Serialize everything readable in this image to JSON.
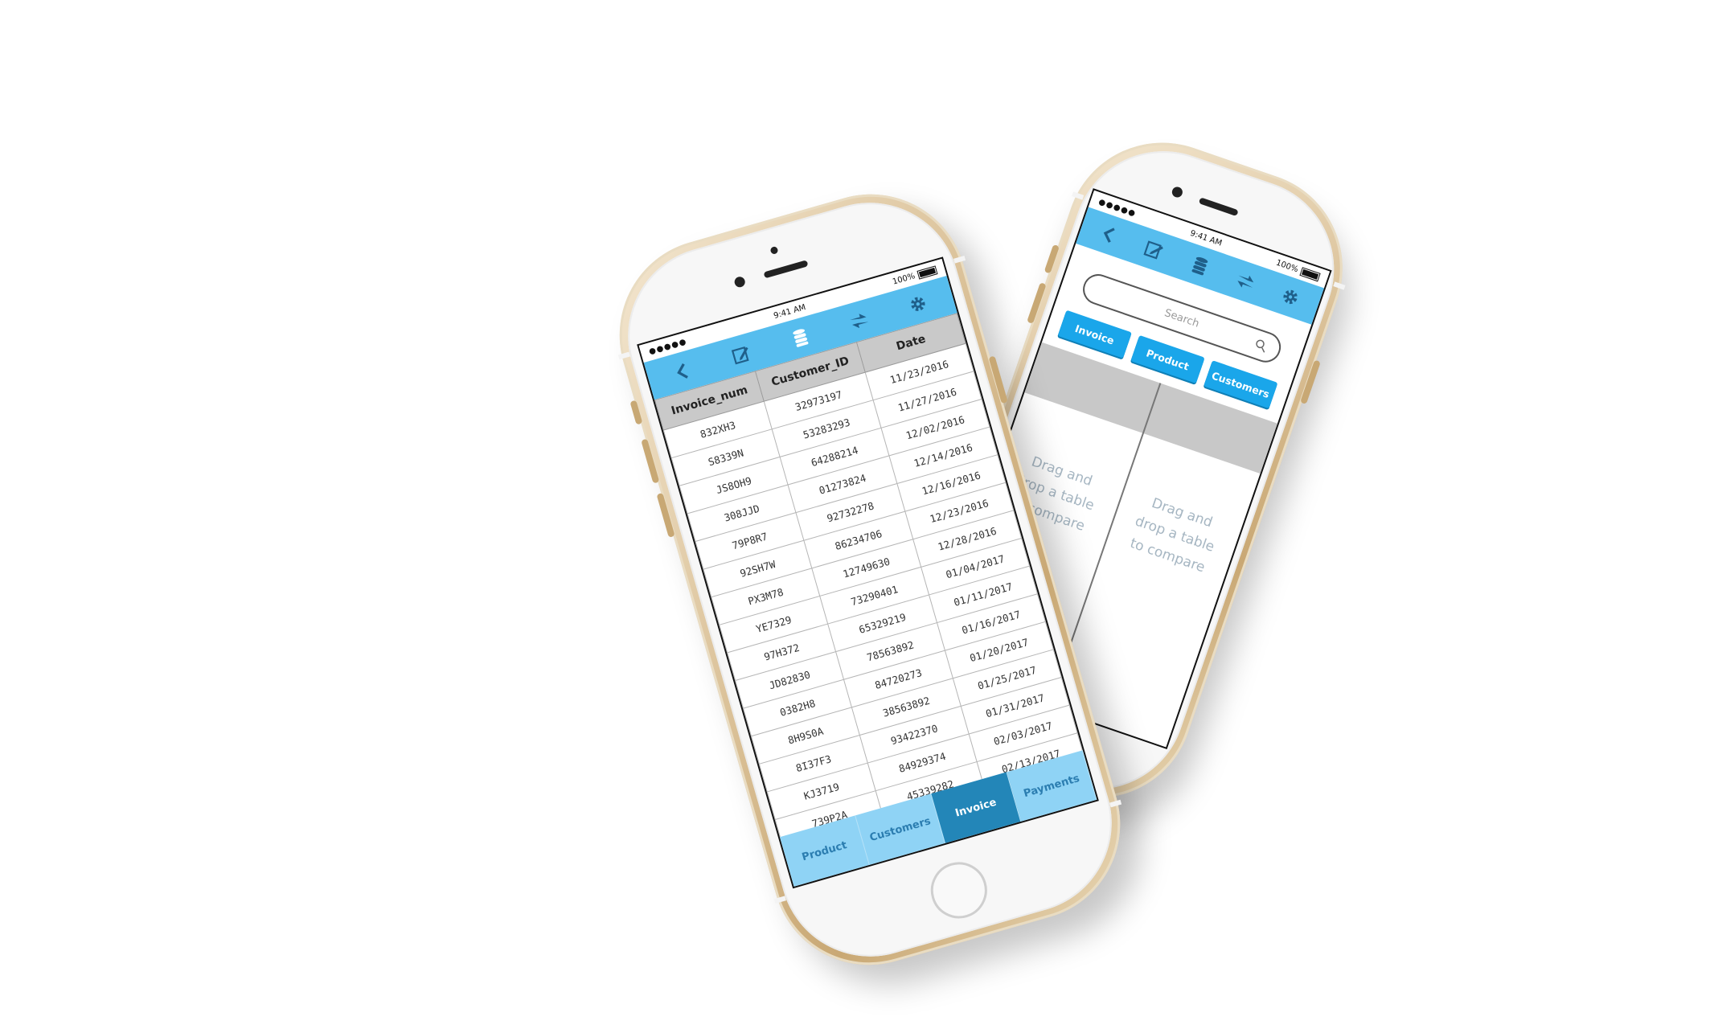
{
  "left_phone": {
    "status": {
      "signal": "●●●●●",
      "time": "9:41 AM",
      "battery": "100%"
    },
    "toolbar_icons": [
      "back-icon",
      "edit-icon",
      "database-icon",
      "compare-icon",
      "gear-icon"
    ],
    "table": {
      "headers": [
        "Invoice_num",
        "Customer_ID",
        "Date"
      ],
      "rows": [
        [
          "832XH3",
          "32973197",
          "11/23/2016"
        ],
        [
          "S8339N",
          "53283293",
          "11/27/2016"
        ],
        [
          "JS8OH9",
          "64288214",
          "12/02/2016"
        ],
        [
          "308JJD",
          "01273824",
          "12/14/2016"
        ],
        [
          "79P8R7",
          "92732278",
          "12/16/2016"
        ],
        [
          "92SH7W",
          "86234706",
          "12/23/2016"
        ],
        [
          "PX3M78",
          "12749630",
          "12/28/2016"
        ],
        [
          "YE7329",
          "73290401",
          "01/04/2017"
        ],
        [
          "97H372",
          "65329219",
          "01/11/2017"
        ],
        [
          "JD82830",
          "78563892",
          "01/16/2017"
        ],
        [
          "0382H8",
          "84720273",
          "01/20/2017"
        ],
        [
          "8H9S0A",
          "38563892",
          "01/25/2017"
        ],
        [
          "8I37F3",
          "93422370",
          "01/31/2017"
        ],
        [
          "KJ3719",
          "84929374",
          "02/03/2017"
        ],
        [
          "739P2A",
          "45339282",
          "02/13/2017"
        ]
      ]
    },
    "bottom_tabs": [
      {
        "label": "Product",
        "active": false
      },
      {
        "label": "Customers",
        "active": false
      },
      {
        "label": "Invoice",
        "active": true
      },
      {
        "label": "Payments",
        "active": false
      }
    ]
  },
  "right_phone": {
    "status": {
      "signal": "●●●●●",
      "time": "9:41 AM",
      "battery": "100%"
    },
    "toolbar_icons": [
      "back-icon",
      "edit-icon",
      "database-icon",
      "compare-icon",
      "gear-icon"
    ],
    "search": {
      "placeholder": "Search"
    },
    "chips": [
      "Invoice",
      "Product",
      "Customers"
    ],
    "drop_hint_left": "Drag and\ndrop a table\nto compare",
    "drop_hint_right": "Drag and\ndrop a table\nto compare"
  },
  "colors": {
    "toolbar": "#56bdee",
    "tab_active": "#2386b8",
    "tab_bg": "#8fd3f5",
    "chip": "#1aa6ea"
  }
}
